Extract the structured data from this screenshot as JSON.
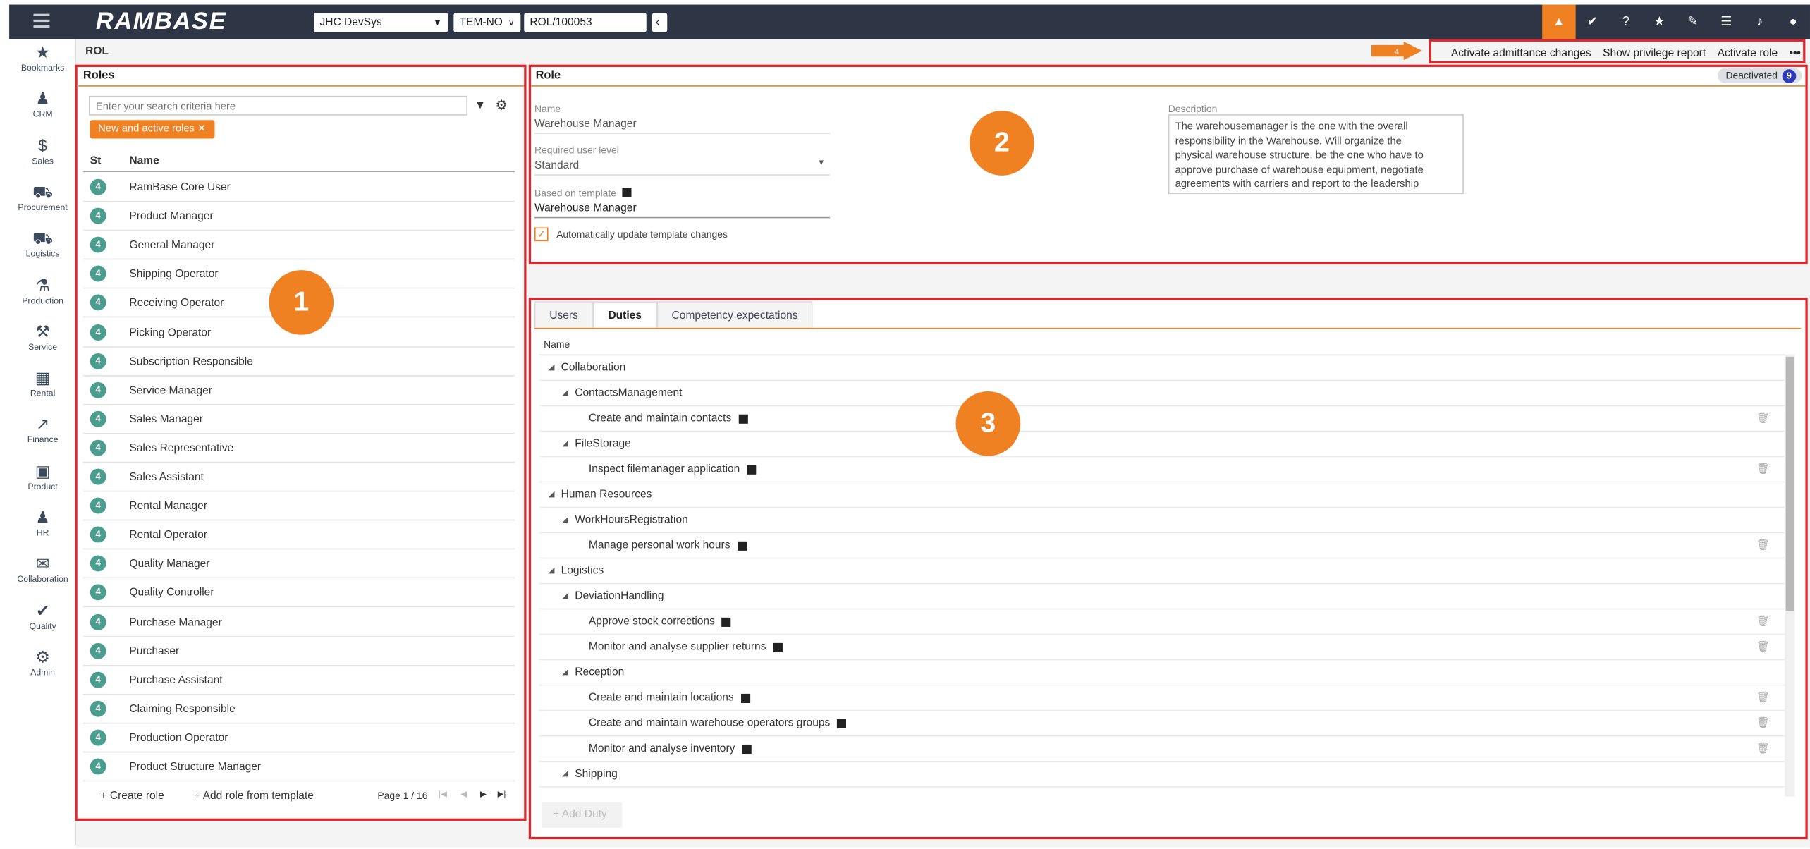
{
  "topbar": {
    "logo": "RAMBASE",
    "company": "JHC DevSys",
    "region": "TEM-NO",
    "location": "ROL/100053",
    "alert_color": "#f08123"
  },
  "sidebar": [
    "Bookmarks",
    "CRM",
    "Sales",
    "Procurement",
    "Logistics",
    "Production",
    "Service",
    "Rental",
    "Finance",
    "Product",
    "HR",
    "Collaboration",
    "Quality",
    "Admin"
  ],
  "header": {
    "title": "ROL",
    "arrow_label": "4",
    "actions": [
      "Activate admittance changes",
      "Show privilege report",
      "Activate role",
      "•••"
    ]
  },
  "roles": {
    "title": "Roles",
    "search_placeholder": "Enter your search criteria here",
    "filter_chip": "New and active roles ✕",
    "col_st": "St",
    "col_name": "Name",
    "status": "4",
    "items": [
      "RamBase Core User",
      "Product Manager",
      "General Manager",
      "Shipping Operator",
      "Receiving Operator",
      "Picking Operator",
      "Subscription Responsible",
      "Service Manager",
      "Sales Manager",
      "Sales Representative",
      "Sales Assistant",
      "Rental Manager",
      "Rental Operator",
      "Quality Manager",
      "Quality Controller",
      "Purchase Manager",
      "Purchaser",
      "Purchase Assistant",
      "Claiming Responsible",
      "Production Operator",
      "Product Structure Manager"
    ],
    "create": "Create role",
    "add_template": "Add role from template",
    "page": "Page 1 / 16"
  },
  "role": {
    "title": "Role",
    "status": "Deactivated",
    "status_count": "9",
    "name_label": "Name",
    "name": "Warehouse Manager",
    "level_label": "Required user level",
    "level": "Standard",
    "template_label": "Based on template",
    "template": "Warehouse Manager",
    "auto_update": "Automatically update template changes",
    "desc_label": "Description",
    "description": "The warehousemanager is the one with the overall responsibility in the Warehouse. Will organize the physical warehouse structure, be the one who have to approve purchase of warehouse equipment, negotiate agreements with carriers and report to the leadership"
  },
  "duties": {
    "tabs": [
      "Users",
      "Duties",
      "Competency expectations"
    ],
    "col_name": "Name",
    "add": "Add Duty",
    "rows": [
      {
        "t": "Collaboration",
        "lvl": 0
      },
      {
        "t": "ContactsManagement",
        "lvl": 1
      },
      {
        "t": "Create and maintain contacts",
        "lvl": 2
      },
      {
        "t": "FileStorage",
        "lvl": 1
      },
      {
        "t": "Inspect filemanager application",
        "lvl": 2
      },
      {
        "t": "Human Resources",
        "lvl": 0
      },
      {
        "t": "WorkHoursRegistration",
        "lvl": 1
      },
      {
        "t": "Manage personal work hours",
        "lvl": 2
      },
      {
        "t": "Logistics",
        "lvl": 0
      },
      {
        "t": "DeviationHandling",
        "lvl": 1
      },
      {
        "t": "Approve stock corrections",
        "lvl": 2
      },
      {
        "t": "Monitor and analyse supplier returns",
        "lvl": 2
      },
      {
        "t": "Reception",
        "lvl": 1
      },
      {
        "t": "Create and maintain locations",
        "lvl": 2
      },
      {
        "t": "Create and maintain warehouse operators groups",
        "lvl": 2
      },
      {
        "t": "Monitor and analyse inventory",
        "lvl": 2
      },
      {
        "t": "Shipping",
        "lvl": 1
      }
    ]
  },
  "callouts": [
    "1",
    "2",
    "3"
  ]
}
